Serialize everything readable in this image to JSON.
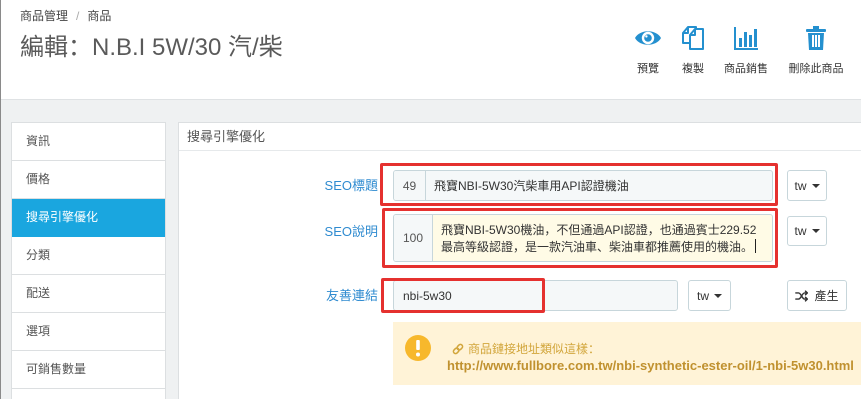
{
  "colors": {
    "accent": "#1aa6df",
    "toolbar_icon": "#2490cf",
    "field_label": "#2f8bd0",
    "annotation_highlight": "#e5312f",
    "warning_background": "#fff3d7",
    "warning_text": "#d2a63c",
    "warning_url": "#c0912f",
    "warning_icon": "#f7b82c"
  },
  "breadcrumb": {
    "items": [
      "商品管理",
      "商品"
    ],
    "separator": "/"
  },
  "page_title": "編輯：N.B.I 5W/30 汽/柴",
  "toolbar": [
    {
      "label": "預覽",
      "icon": "eye-icon"
    },
    {
      "label": "複製",
      "icon": "copy-icon"
    },
    {
      "label": "商品銷售",
      "icon": "bar-chart-icon"
    },
    {
      "label": "刪除此商品",
      "icon": "trash-icon"
    }
  ],
  "sidebar": {
    "items": [
      {
        "label": "資訊",
        "active": false
      },
      {
        "label": "價格",
        "active": false
      },
      {
        "label": "搜尋引擎優化",
        "active": true
      },
      {
        "label": "分類",
        "active": false
      },
      {
        "label": "配送",
        "active": false
      },
      {
        "label": "選項",
        "active": false
      },
      {
        "label": "可銷售數量",
        "active": false
      }
    ]
  },
  "seo_panel": {
    "heading": "搜尋引擎優化",
    "meta_title": {
      "label": "SEO標題",
      "char_count": "49",
      "value": "飛寶NBI-5W30汽柴車用API認證機油",
      "language": "tw"
    },
    "meta_description": {
      "label": "SEO說明",
      "char_count": "100",
      "value": "飛寶NBI-5W30機油，不但通過API認證，也通過賓士229.52最高等級認證，是一款汽油車、柴油車都推薦使用的機油。",
      "language": "tw"
    },
    "friendly_url": {
      "label": "友善連結",
      "value": "nbi-5w30",
      "language": "tw",
      "generate_button": {
        "label": "產生",
        "icon": "random-icon"
      }
    },
    "url_hint": {
      "icon": "warning-icon",
      "link_icon": "link-icon",
      "title": "商品鏈接地址類似這樣：",
      "example_url": "http://www.fullbore.com.tw/nbi-synthetic-ester-oil/1-nbi-5w30.html"
    }
  }
}
